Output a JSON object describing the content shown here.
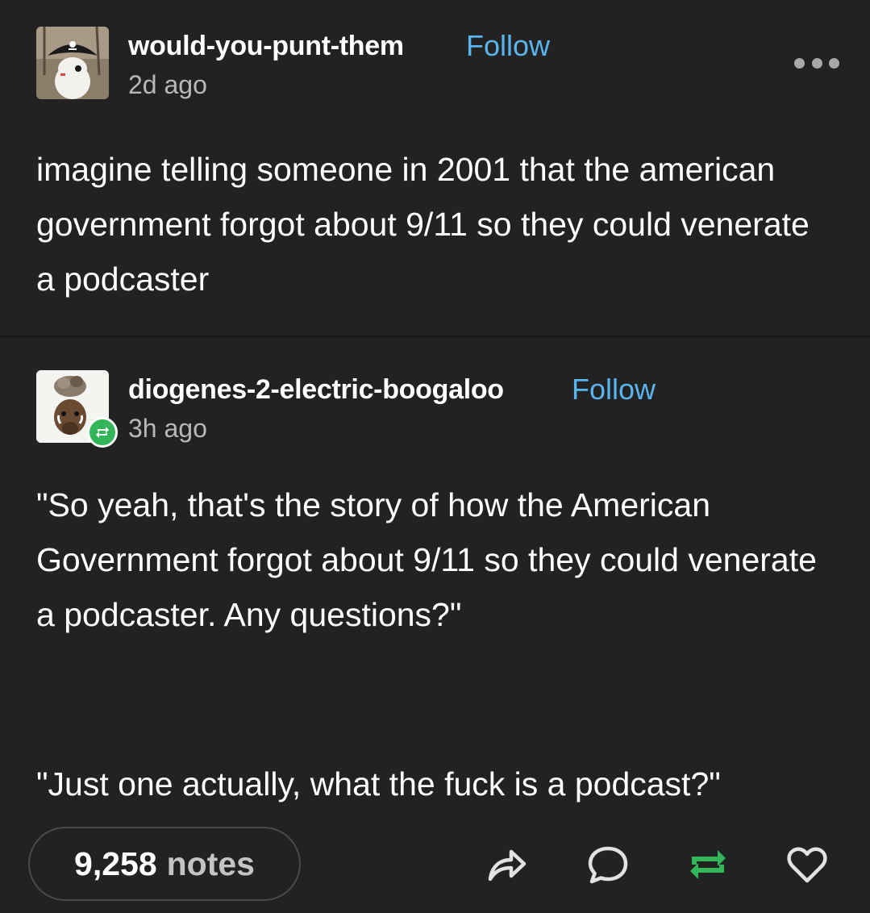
{
  "posts": [
    {
      "username": "would-you-punt-them",
      "follow_label": "Follow",
      "timestamp": "2d ago",
      "avatar_icon": "pirate-avatar-icon",
      "body": "imagine telling someone in 2001 that the american government forgot about 9/11 so they could venerate a podcaster"
    },
    {
      "username": "diogenes-2-electric-boogaloo",
      "follow_label": "Follow",
      "timestamp": "3h ago",
      "avatar_icon": "boar-avatar-icon",
      "reblog_badge_icon": "reblog-badge-icon",
      "paragraphs": [
        "\"So yeah, that's the story of how the American Government forgot about 9/11 so they could venerate a podcaster. Any questions?\"",
        "\"Just one actually, what the fuck is a podcast?\""
      ]
    }
  ],
  "footer": {
    "notes_count": "9,258",
    "notes_label": "notes",
    "actions": [
      "share-icon",
      "reply-icon",
      "reblog-icon",
      "like-icon"
    ]
  },
  "colors": {
    "background": "#222222",
    "link": "#5ab4ee",
    "reblog_green": "#33b55a",
    "text": "#ffffff",
    "muted": "#b8b8b8"
  }
}
